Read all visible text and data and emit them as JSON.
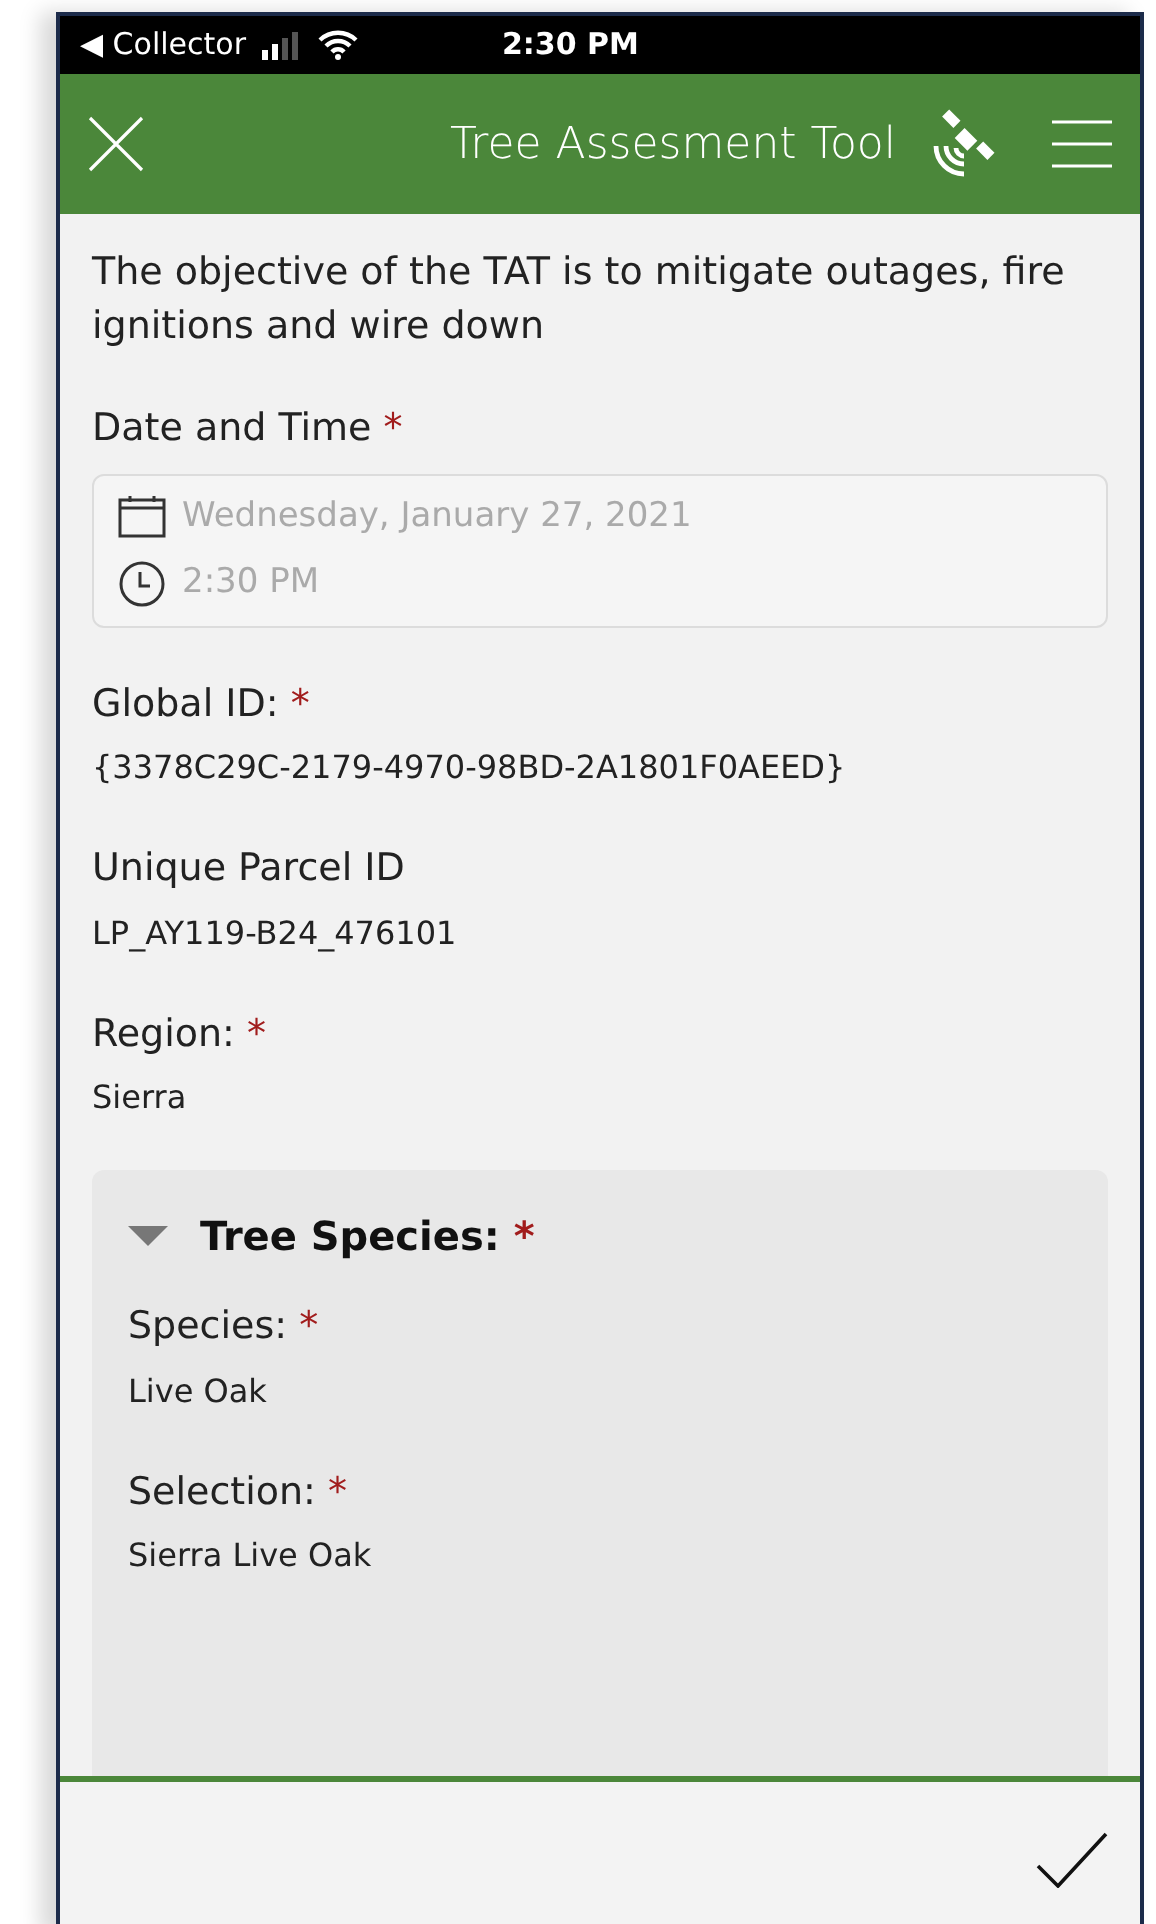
{
  "status_bar": {
    "back_app": "◀ Collector",
    "time": "2:30 PM"
  },
  "header": {
    "title": "Tree Assesment Tool"
  },
  "intro": "The objective of the TAT is to mitigate outages, fire ignitions and wire down",
  "date_time": {
    "label": "Date and Time",
    "required_mark": "*",
    "date_placeholder": "Wednesday, January 27, 2021",
    "time_placeholder": "2:30 PM"
  },
  "fields": [
    {
      "label": "Global ID:",
      "required_mark": "*",
      "value": "{3378C29C-2179-4970-98BD-2A1801F0AEED}"
    },
    {
      "label": "Unique Parcel ID",
      "value": "LP_AY119-B24_476101"
    },
    {
      "label": "Region:",
      "required_mark": "*",
      "value": "Sierra"
    }
  ],
  "group": {
    "title": "Tree Species:",
    "required_mark": "*",
    "expanded": true,
    "fields": [
      {
        "label": "Species:",
        "required_mark": "*",
        "value": "Live Oak"
      },
      {
        "label": "Selection:",
        "required_mark": "*",
        "value": "Sierra Live Oak"
      }
    ]
  }
}
